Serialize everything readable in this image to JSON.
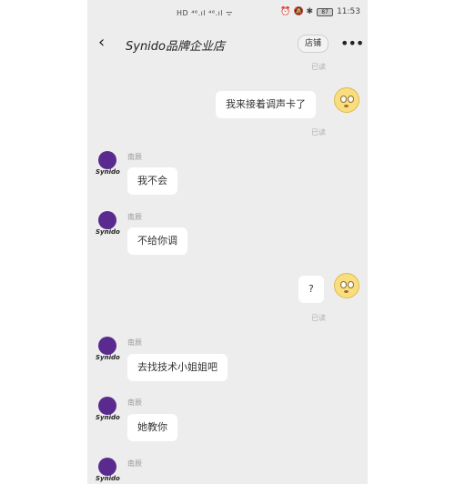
{
  "status_bar": {
    "carrier": "HD ⁴⁶.ıl ⁴⁶.ıl ᯤ",
    "icons": "⏰ 🔕 ✱",
    "battery": "87",
    "time": "11:53"
  },
  "header": {
    "title": "Synido品牌企业店",
    "shop_label": "店铺"
  },
  "avatar": {
    "logo_text": "Synido"
  },
  "messages": {
    "read_top": "已读",
    "m1_text": "我来接着调声卡了",
    "m1_read": "已读",
    "m2_sender": "南辰",
    "m2_text": "我不会",
    "m3_sender": "南辰",
    "m3_text": "不给你调",
    "m4_text": "?",
    "m4_read": "已读",
    "m5_sender": "南辰",
    "m5_text": "去找技术小姐姐吧",
    "m6_sender": "南辰",
    "m6_text": "她教你",
    "m7_sender": "南辰"
  }
}
